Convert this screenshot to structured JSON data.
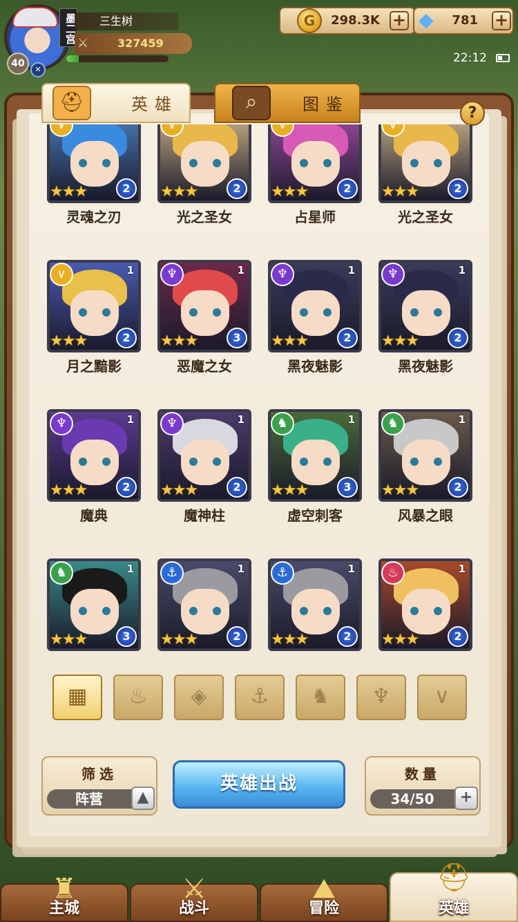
{
  "player": {
    "guild_tag": "墨二宫",
    "name": "三生树",
    "power": "327459",
    "level": "40",
    "exp_fraction": 0.12
  },
  "resources": {
    "gold": "298.3K",
    "gems": "781",
    "plus_label": "+"
  },
  "status": {
    "time": "22:12"
  },
  "tabs": {
    "heroes_label": "英雄",
    "codex_label": "图鉴",
    "help_label": "?"
  },
  "heroes": [
    {
      "name": "灵魂之刃",
      "faction": "light",
      "stars": "★★★",
      "grade": "2",
      "count": "",
      "hair": "#3a8ae0",
      "bg": "#4a7ab8"
    },
    {
      "name": "光之圣女",
      "faction": "light",
      "stars": "★★★",
      "grade": "2",
      "count": "",
      "hair": "#e8b84a",
      "bg": "#c8b088"
    },
    {
      "name": "占星师",
      "faction": "light",
      "stars": "★★★",
      "grade": "2",
      "count": "",
      "hair": "#d85ab8",
      "bg": "#9a4aa0"
    },
    {
      "name": "光之圣女",
      "faction": "light",
      "stars": "★★★",
      "grade": "2",
      "count": "",
      "hair": "#e8b84a",
      "bg": "#c8b088"
    },
    {
      "name": "月之黯影",
      "faction": "light",
      "stars": "★★★",
      "grade": "2",
      "count": "1",
      "hair": "#e8c04a",
      "bg": "#4a5ab0"
    },
    {
      "name": "恶魔之女",
      "faction": "dark",
      "stars": "★★★",
      "grade": "3",
      "count": "1",
      "hair": "#e04a4a",
      "bg": "#6a2a4a"
    },
    {
      "name": "黑夜魅影",
      "faction": "dark",
      "stars": "★★★",
      "grade": "2",
      "count": "1",
      "hair": "#2a2a4a",
      "bg": "#3a3a5a"
    },
    {
      "name": "黑夜魅影",
      "faction": "dark",
      "stars": "★★★",
      "grade": "2",
      "count": "1",
      "hair": "#2a2a4a",
      "bg": "#3a3a5a"
    },
    {
      "name": "魔典",
      "faction": "dark",
      "stars": "★★★",
      "grade": "2",
      "count": "1",
      "hair": "#6a3ab0",
      "bg": "#5a3a90"
    },
    {
      "name": "魔神柱",
      "faction": "dark",
      "stars": "★★★",
      "grade": "2",
      "count": "1",
      "hair": "#d8d8e0",
      "bg": "#4a3a6a"
    },
    {
      "name": "虚空刺客",
      "faction": "nature",
      "stars": "★★★",
      "grade": "3",
      "count": "1",
      "hair": "#3ab08a",
      "bg": "#4a6a3a"
    },
    {
      "name": "风暴之眼",
      "faction": "nature",
      "stars": "★★★",
      "grade": "2",
      "count": "1",
      "hair": "#c8c8c8",
      "bg": "#6a5a4a"
    },
    {
      "name": "",
      "faction": "nature",
      "stars": "★★★",
      "grade": "3",
      "count": "1",
      "hair": "#1a1a1a",
      "bg": "#3a8a8a"
    },
    {
      "name": "",
      "faction": "water",
      "stars": "★★★",
      "grade": "2",
      "count": "1",
      "hair": "#9a9aa0",
      "bg": "#4a4a6a"
    },
    {
      "name": "",
      "faction": "water",
      "stars": "★★★",
      "grade": "2",
      "count": "1",
      "hair": "#9a9aa0",
      "bg": "#4a4a6a"
    },
    {
      "name": "",
      "faction": "fire",
      "stars": "★★★",
      "grade": "2",
      "count": "1",
      "hair": "#f0c060",
      "bg": "#a84a2a"
    }
  ],
  "faction_colors": {
    "light": "#e8b020",
    "dark": "#7a3ad0",
    "nature": "#3aa04a",
    "water": "#2a6ad8",
    "fire": "#d83a5a"
  },
  "faction_icons": {
    "light": "chevron-v-icon",
    "dark": "horned-icon",
    "nature": "beast-icon",
    "water": "anchor-icon",
    "fire": "flame-icon"
  },
  "filters": [
    {
      "name": "all",
      "icon": "grid-icon",
      "active": true
    },
    {
      "name": "fire",
      "icon": "flame-icon",
      "active": false
    },
    {
      "name": "diamond",
      "icon": "diamond-icon",
      "active": false
    },
    {
      "name": "water",
      "icon": "anchor-icon",
      "active": false
    },
    {
      "name": "nature",
      "icon": "beast-icon",
      "active": false
    },
    {
      "name": "dark",
      "icon": "horned-icon",
      "active": false
    },
    {
      "name": "light",
      "icon": "chevron-v-icon",
      "active": false
    }
  ],
  "controls": {
    "filter_title": "筛选",
    "filter_value": "阵营",
    "deploy_label": "英雄出战",
    "count_title": "数量",
    "count_value": "34/50"
  },
  "nav": [
    {
      "label": "主城",
      "icon": "castle-icon"
    },
    {
      "label": "战斗",
      "icon": "crossed-swords-icon"
    },
    {
      "label": "冒险",
      "icon": "map-icon"
    },
    {
      "label": "英雄",
      "icon": "hero-helmet-icon",
      "active": true
    }
  ]
}
